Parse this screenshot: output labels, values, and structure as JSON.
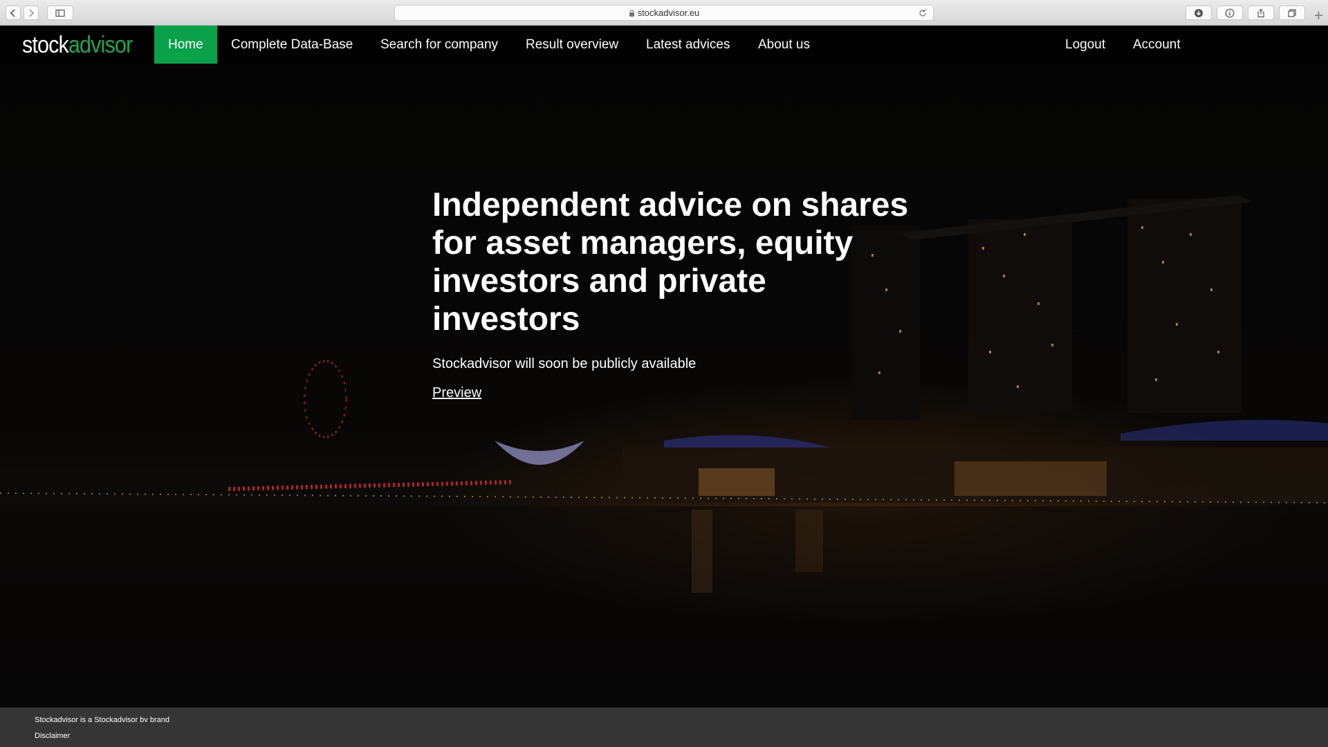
{
  "browser": {
    "url": "stockadvisor.eu",
    "icons": [
      "back-icon",
      "forward-icon",
      "sidebar-icon",
      "lock-icon",
      "reload-icon",
      "download-icon",
      "info-icon",
      "share-icon",
      "tabs-icon",
      "new-tab-icon"
    ]
  },
  "site": {
    "logo": {
      "part1": "stock",
      "part2": "advisor"
    },
    "nav": {
      "items": [
        {
          "label": "Home",
          "active": true
        },
        {
          "label": "Complete Data-Base"
        },
        {
          "label": "Search for company"
        },
        {
          "label": "Result overview"
        },
        {
          "label": "Latest advices"
        },
        {
          "label": "About us"
        }
      ],
      "right": [
        {
          "label": "Logout"
        },
        {
          "label": "Account"
        }
      ]
    },
    "hero": {
      "headline": "Independent advice on shares for asset managers, equity investors and private investors",
      "subtext": "Stockadvisor will soon be publicly available",
      "preview_link": "Preview"
    },
    "footer": {
      "brand_line": "Stockadvisor is a Stockadvisor bv brand",
      "disclaimer": "Disclaimer"
    }
  },
  "colors": {
    "accent_green": "#0aa14a",
    "logo_green": "#1ea84f",
    "nav_bg": "#000000",
    "footer_bg": "#353535"
  }
}
